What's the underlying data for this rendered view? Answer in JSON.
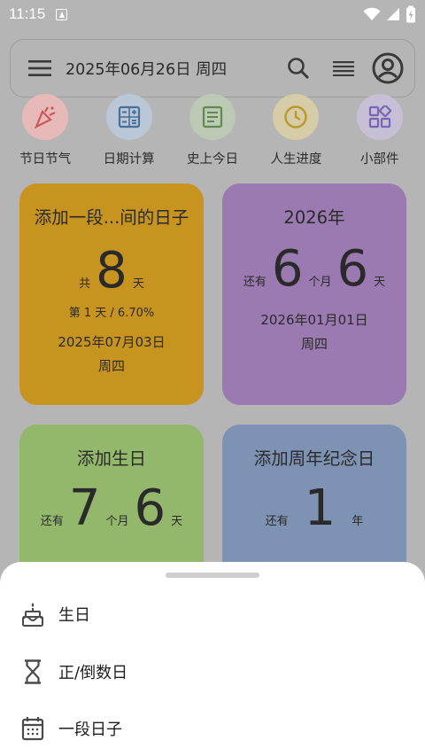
{
  "status": {
    "time": "11:15"
  },
  "header": {
    "date": "2025年06月26日 周四"
  },
  "quick_actions": [
    {
      "label": "节日节气",
      "icon": "party-popper-icon",
      "bg": "#e8b9b9",
      "color": "#c95858"
    },
    {
      "label": "日期计算",
      "icon": "calculator-icon",
      "bg": "#b9c7d6",
      "color": "#4a6f9a"
    },
    {
      "label": "史上今日",
      "icon": "document-icon",
      "bg": "#bccab5",
      "color": "#5e8a4f"
    },
    {
      "label": "人生进度",
      "icon": "clock-icon",
      "bg": "#d6cca7",
      "color": "#b99a2a"
    },
    {
      "label": "小部件",
      "icon": "widgets-icon",
      "bg": "#c6bfd5",
      "color": "#7a64b5"
    }
  ],
  "cards": {
    "period": {
      "title": "添加一段...间的日子",
      "prefix": "共",
      "number": "8",
      "unit": "天",
      "progress": "第 1 天 / 6.70%",
      "date": "2025年07月03日",
      "weekday": "周四",
      "color": "#c79420"
    },
    "year": {
      "title": "2026年",
      "prefix": "还有",
      "num1": "6",
      "unit1": "个月",
      "num2": "6",
      "unit2": "天",
      "date": "2026年01月01日",
      "weekday": "周四",
      "color": "#9a7ab1"
    },
    "birthday": {
      "title": "添加生日",
      "prefix": "还有",
      "num1": "7",
      "unit1": "个月",
      "num2": "6",
      "unit2": "天",
      "color": "#93b86c"
    },
    "anniversary": {
      "title": "添加周年纪念日",
      "prefix": "还有",
      "number": "1",
      "unit": "年",
      "color": "#7e93b4"
    }
  },
  "sheet": {
    "items": [
      {
        "label": "生日",
        "icon": "cake-icon"
      },
      {
        "label": "正/倒数日",
        "icon": "hourglass-icon"
      },
      {
        "label": "一段日子",
        "icon": "calendar-icon"
      }
    ]
  }
}
